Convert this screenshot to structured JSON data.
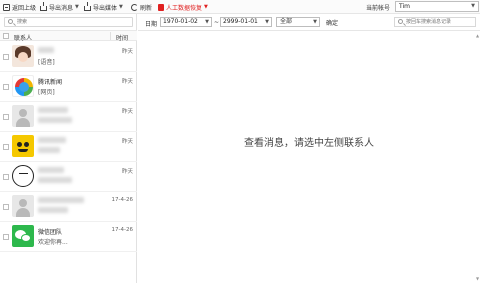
{
  "toolbar": {
    "back": "返回上级",
    "export_messages": "导出消息",
    "export_media": "导出媒体",
    "refresh": "刷新",
    "manual_recovery": "人工数据恢复",
    "dropdown_glyph": "▼",
    "account_label": "当前帐号",
    "account_value": "Tim"
  },
  "left_panel": {
    "search_placeholder": "搜索",
    "col_contact": "联系人",
    "col_time": "时间",
    "contacts": [
      {
        "avatar": "girl-photo-avatar",
        "name": "",
        "preview": "[语音]",
        "time": "昨天"
      },
      {
        "avatar": "tencent-news-icon",
        "name": "腾讯新闻",
        "preview": "[网页]",
        "time": "昨天"
      },
      {
        "avatar": "default-user-icon",
        "name": "",
        "preview": "",
        "time": "昨天"
      },
      {
        "avatar": "yellow-face-avatar",
        "name": "",
        "preview": "",
        "time": "昨天"
      },
      {
        "avatar": "yi-logo-avatar",
        "name": "",
        "preview": "",
        "time": "昨天"
      },
      {
        "avatar": "default-user-icon",
        "name": "",
        "preview": "",
        "time": "17-4-26"
      },
      {
        "avatar": "wechat-team-icon",
        "name": "微信团队",
        "preview": "欢迎你再...",
        "time": "17-4-26"
      }
    ]
  },
  "right_panel": {
    "date_label": "日期",
    "date_from": "1970-01-02",
    "date_sep": "~",
    "date_to": "2999-01-01",
    "filter_all": "全部",
    "confirm": "确定",
    "search_placeholder": "按回车搜索消息记录",
    "empty_message": "查看消息，请选中左侧联系人"
  },
  "colors": {
    "accent_red": "#e02020",
    "wechat_green": "#2db84c"
  }
}
